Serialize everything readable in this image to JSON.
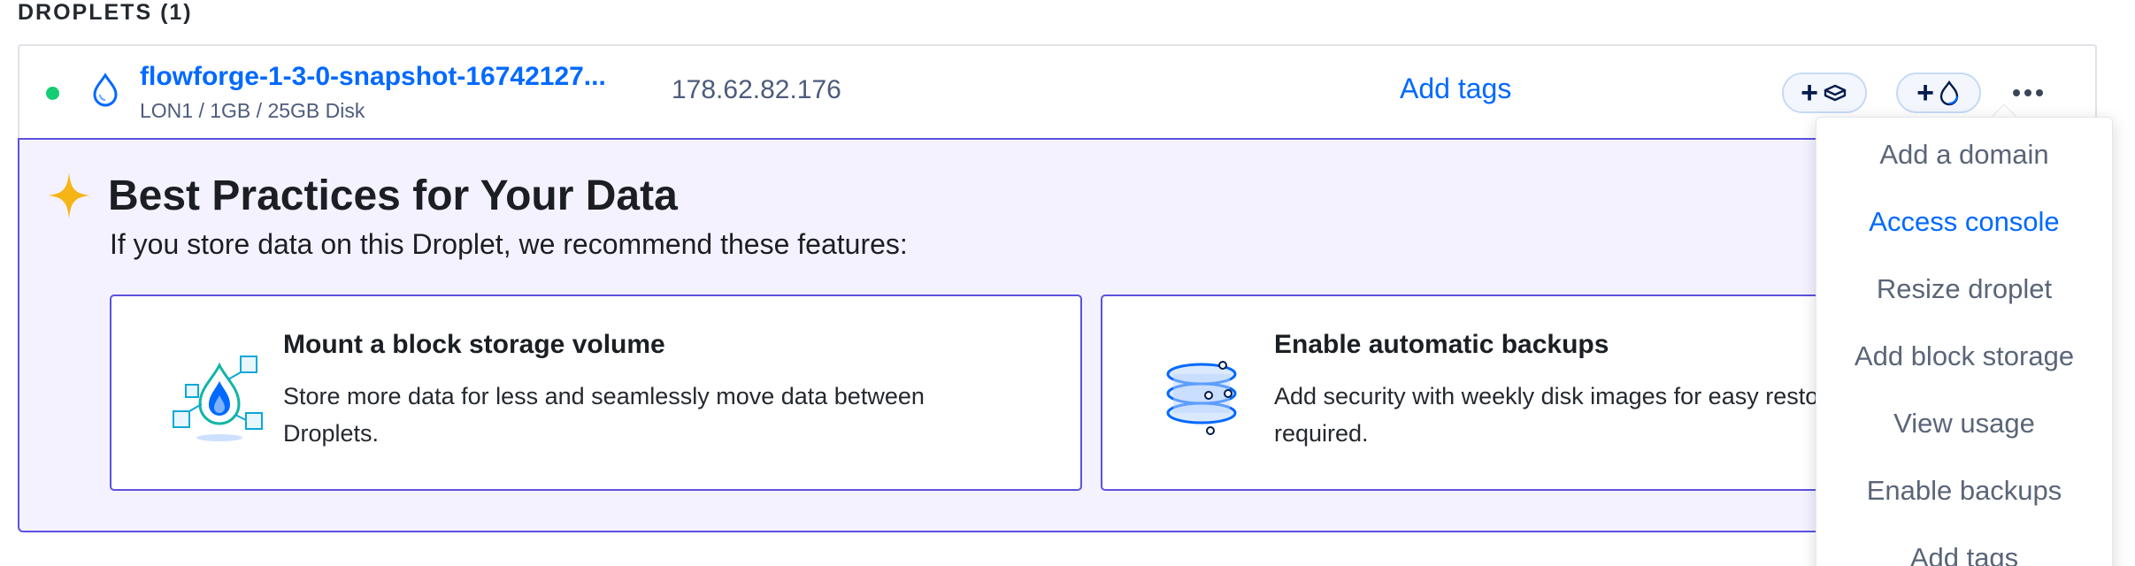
{
  "section": {
    "label": "DROPLETS (1)"
  },
  "droplet": {
    "name": "flowforge-1-3-0-snapshot-16742127...",
    "spec": "LON1 / 1GB / 25GB Disk",
    "ip": "178.62.82.176",
    "status_color": "#15cd72",
    "add_tags_label": "Add tags",
    "volume_button_icon": "volume-icon",
    "backup_button_icon": "backup-icon",
    "more_icon": "more-horizontal-icon"
  },
  "best_practices": {
    "title": "Best Practices for Your Data",
    "subtitle": "If you store data on this Droplet, we recommend these features:",
    "star_color": "#f5b517",
    "cards": [
      {
        "title": "Mount a block storage volume",
        "text": "Store more data for less and seamlessly move data between Droplets.",
        "icon": "block-storage-illustration"
      },
      {
        "title": "Enable automatic backups",
        "text": "Add security with weekly disk images for easy resto configuration required.",
        "icon": "backups-illustration"
      }
    ]
  },
  "menu": {
    "items": [
      {
        "label": "Add a domain"
      },
      {
        "label": "Access console",
        "active": true
      },
      {
        "label": "Resize droplet"
      },
      {
        "label": "Add block storage"
      },
      {
        "label": "View usage"
      },
      {
        "label": "Enable backups"
      },
      {
        "label": "Add tags"
      }
    ]
  },
  "colors": {
    "accent_blue": "#0069ff",
    "panel_border": "#5c52e0",
    "panel_bg": "#f4f2ff"
  }
}
